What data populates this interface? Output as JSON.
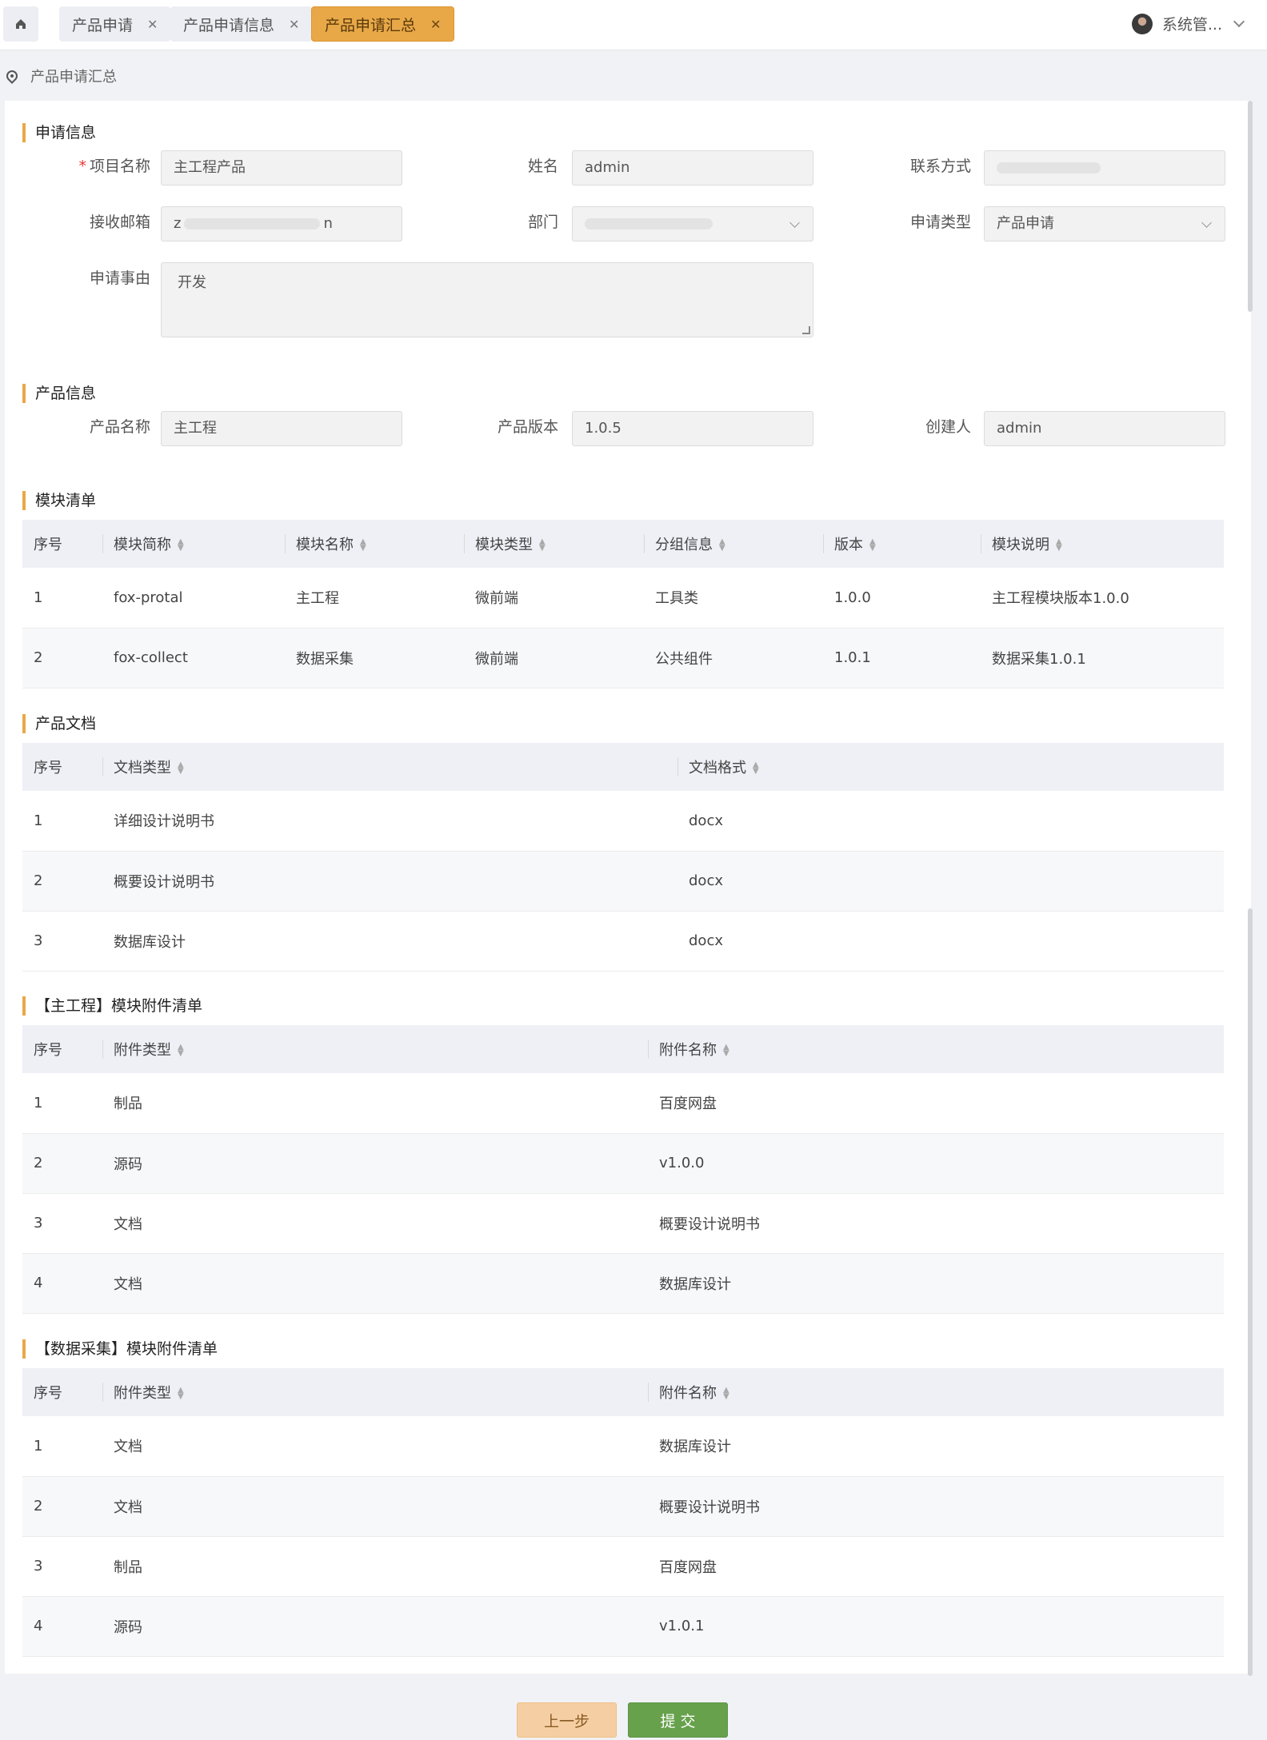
{
  "tabs": [
    {
      "label": "产品申请"
    },
    {
      "label": "产品申请信息"
    },
    {
      "label": "产品申请汇总"
    }
  ],
  "user": {
    "name": "系统管..."
  },
  "breadcrumb": {
    "label": "产品申请汇总"
  },
  "application_info": {
    "title": "申请信息",
    "project_name_label": "项目名称",
    "project_name_value": "主工程产品",
    "name_label": "姓名",
    "name_value": "admin",
    "contact_label": "联系方式",
    "email_label": "接收邮箱",
    "email_value_prefix": "z",
    "email_value_suffix": "n",
    "department_label": "部门",
    "type_label": "申请类型",
    "type_value": "产品申请",
    "reason_label": "申请事由",
    "reason_value": "开发"
  },
  "product_info": {
    "title": "产品信息",
    "product_name_label": "产品名称",
    "product_name_value": "主工程",
    "version_label": "产品版本",
    "version_value": "1.0.5",
    "creator_label": "创建人",
    "creator_value": "admin"
  },
  "module_list": {
    "title": "模块清单",
    "headers": [
      "序号",
      "模块简称",
      "模块名称",
      "模块类型",
      "分组信息",
      "版本",
      "模块说明"
    ],
    "rows": [
      [
        "1",
        "fox-protal",
        "主工程",
        "微前端",
        "工具类",
        "1.0.0",
        "主工程模块版本1.0.0"
      ],
      [
        "2",
        "fox-collect",
        "数据采集",
        "微前端",
        "公共组件",
        "1.0.1",
        "数据采集1.0.1"
      ]
    ]
  },
  "product_docs": {
    "title": "产品文档",
    "headers": [
      "序号",
      "文档类型",
      "文档格式"
    ],
    "rows": [
      [
        "1",
        "详细设计说明书",
        "docx"
      ],
      [
        "2",
        "概要设计说明书",
        "docx"
      ],
      [
        "3",
        "数据库设计",
        "docx"
      ]
    ]
  },
  "main_attachments": {
    "title": "【主工程】模块附件清单",
    "headers": [
      "序号",
      "附件类型",
      "附件名称"
    ],
    "rows": [
      [
        "1",
        "制品",
        "百度网盘"
      ],
      [
        "2",
        "源码",
        "v1.0.0"
      ],
      [
        "3",
        "文档",
        "概要设计说明书"
      ],
      [
        "4",
        "文档",
        "数据库设计"
      ]
    ]
  },
  "collect_attachments": {
    "title": "【数据采集】模块附件清单",
    "headers": [
      "序号",
      "附件类型",
      "附件名称"
    ],
    "rows": [
      [
        "1",
        "文档",
        "数据库设计"
      ],
      [
        "2",
        "文档",
        "概要设计说明书"
      ],
      [
        "3",
        "制品",
        "百度网盘"
      ],
      [
        "4",
        "源码",
        "v1.0.1"
      ]
    ]
  },
  "footer": {
    "prev_label": "上一步",
    "submit_label": "提 交"
  }
}
